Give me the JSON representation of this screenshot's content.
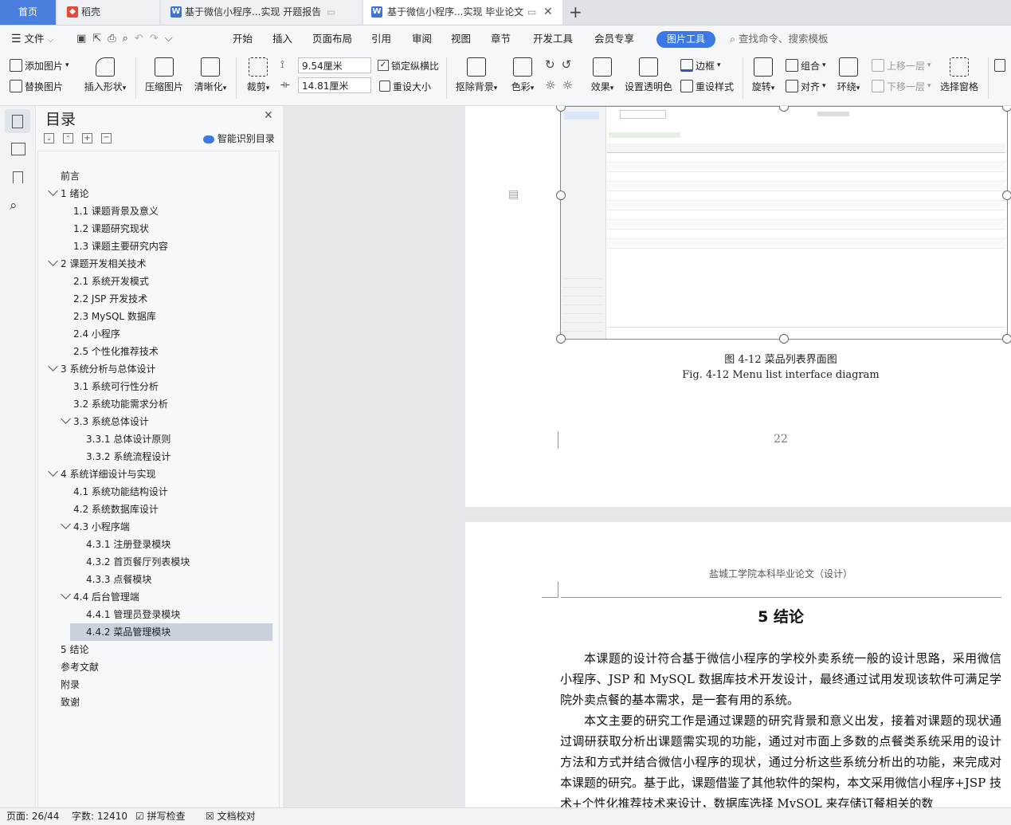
{
  "tabs": [
    {
      "label": "首页"
    },
    {
      "label": "稻壳"
    },
    {
      "label": "基于微信小程序...实现 开题报告"
    },
    {
      "label": "基于微信小程序...实现 毕业论文"
    }
  ],
  "new_tab_symbol": "+",
  "menu": {
    "file": "文件",
    "items": [
      "开始",
      "插入",
      "页面布局",
      "引用",
      "审阅",
      "视图",
      "章节",
      "开发工具",
      "会员专享"
    ],
    "active_tab": "图片工具",
    "search_placeholder": "查找命令、搜索模板"
  },
  "ribbon": {
    "add_image": "添加图片",
    "replace_image": "替换图片",
    "insert_shape": "插入形状",
    "compress": "压缩图片",
    "clarify": "清晰化",
    "crop": "裁剪",
    "height_value": "9.54厘米",
    "width_value": "14.81厘米",
    "lock_ratio": "锁定纵横比",
    "reset_size": "重设大小",
    "remove_bg": "抠除背景",
    "color": "色彩",
    "effects": "效果",
    "transparent": "设置透明色",
    "border": "边框",
    "reset_style": "重设样式",
    "rotate": "旋转",
    "group": "组合",
    "align": "对齐",
    "wrap": "环绕",
    "bring_forward": "上移一层",
    "send_backward": "下移一层",
    "selection_pane": "选择窗格"
  },
  "outline": {
    "title": "目录",
    "smart_toc": "智能识别目录",
    "items": [
      {
        "label": "前言"
      },
      {
        "label": "1 绪论"
      },
      {
        "label": "1.1 课题背景及意义"
      },
      {
        "label": "1.2 课题研究现状"
      },
      {
        "label": "1.3 课题主要研究内容"
      },
      {
        "label": "2 课题开发相关技术"
      },
      {
        "label": "2.1 系统开发模式"
      },
      {
        "label": "2.2 JSP 开发技术"
      },
      {
        "label": "2.3 MySQL 数据库"
      },
      {
        "label": "2.4  小程序"
      },
      {
        "label": "2.5  个性化推荐技术"
      },
      {
        "label": "3 系统分析与总体设计"
      },
      {
        "label": "3.1 系统可行性分析"
      },
      {
        "label": "3.2 系统功能需求分析"
      },
      {
        "label": "3.3 系统总体设计"
      },
      {
        "label": "3.3.1 总体设计原则"
      },
      {
        "label": "3.3.2 系统流程设计"
      },
      {
        "label": "4 系统详细设计与实现"
      },
      {
        "label": "4.1 系统功能结构设计"
      },
      {
        "label": "4.2 系统数据库设计"
      },
      {
        "label": "4.3 小程序端"
      },
      {
        "label": "4.3.1 注册登录模块"
      },
      {
        "label": "4.3.2 首页餐厅列表模块"
      },
      {
        "label": "4.3.3 点餐模块"
      },
      {
        "label": "4.4 后台管理端"
      },
      {
        "label": "4.4.1 管理员登录模块"
      },
      {
        "label": "4.4.2 菜品管理模块"
      },
      {
        "label": "5 结论"
      },
      {
        "label": "参考文献"
      },
      {
        "label": "附录"
      },
      {
        "label": "致谢"
      }
    ]
  },
  "document": {
    "figure_caption_cn": "图 4-12  菜品列表界面图",
    "figure_caption_en": "Fig. 4-12 Menu list interface diagram",
    "page_number": "22",
    "header": "盐城工学院本科毕业论文（设计）",
    "chapter_title": "5 结论",
    "para1": "本课题的设计符合基于微信小程序的学校外卖系统一般的设计思路，采用微信小程序、JSP 和 MySQL 数据库技术开发设计，最终通过试用发现该软件可满足学院外卖点餐的基本需求，是一套有用的系统。",
    "para2": "本文主要的研究工作是通过课题的研究背景和意义出发，接着对课题的现状通过调研获取分析出课题需实现的功能，通过对市面上多数的点餐类系统采用的设计方法和方式并结合微信小程序的现状，通过分析这些系统分析出的功能，来完成对本课题的研究。基于此，课题借鉴了其他软件的架构，本文采用微信小程序+JSP 技术+个性化推荐技术来设计，数据库选择 MySQL 来存储订餐相关的数"
  },
  "status": {
    "page": "页面: 26/44",
    "words": "字数: 12410",
    "spell": "拼写检查",
    "proof": "文档校对"
  },
  "colors": {
    "accent": "#3c78e6",
    "home_tab": "#4a7fe0",
    "selected_row": "#c9d1dc"
  }
}
